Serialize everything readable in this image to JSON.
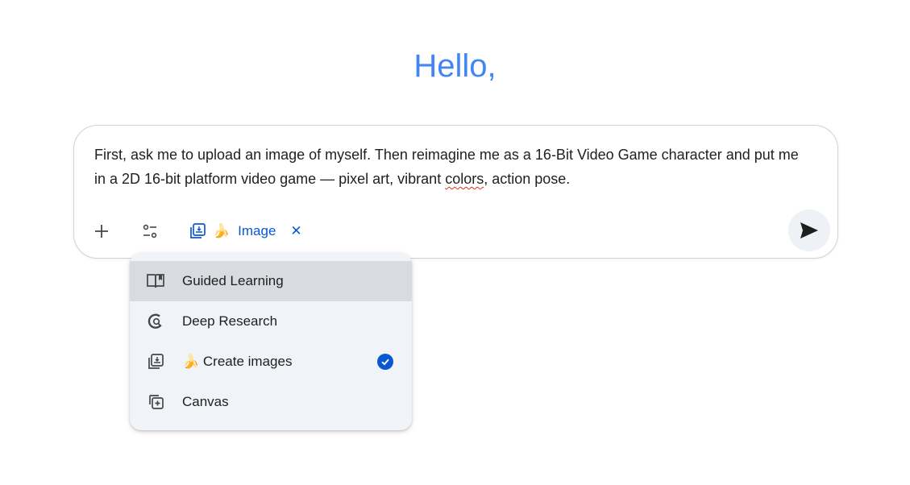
{
  "greeting": "Hello,",
  "composer": {
    "prompt_part1": "First, ask me to upload an image of myself. Then reimagine me as a 16-Bit Video Game character and put me in a 2D 16-bit platform video game — pixel art, vibrant ",
    "prompt_misspelled": "colors",
    "prompt_part2": ", action pose.",
    "chip": {
      "emoji": "🍌",
      "label": "Image",
      "close": "✕"
    },
    "add_icon": "plus-icon",
    "tools_icon": "tune-icon",
    "send_icon": "send-icon"
  },
  "tools_menu": {
    "items": [
      {
        "label": "Guided Learning",
        "icon": "book-icon",
        "active": true
      },
      {
        "label": "Deep Research",
        "icon": "deep-research-icon"
      },
      {
        "emoji": "🍌",
        "label": "Create images",
        "icon": "image-gallery-icon",
        "selected": true
      },
      {
        "label": "Canvas",
        "icon": "canvas-icon"
      }
    ]
  },
  "colors": {
    "greeting": "#4285f4",
    "accent": "#0b57d0",
    "menu_bg": "#f0f4f9",
    "menu_active": "#d8dbdf"
  }
}
